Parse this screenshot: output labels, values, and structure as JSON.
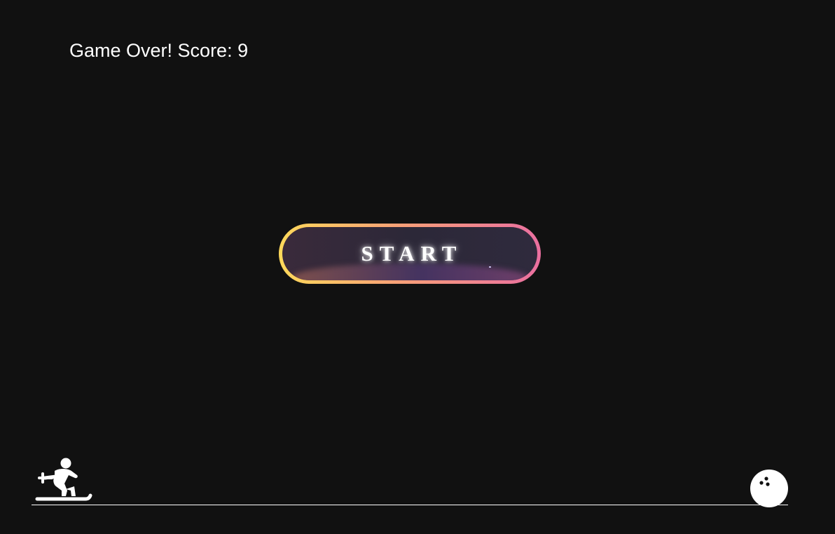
{
  "hud": {
    "status_text": "Game Over! Score: 9",
    "score": 9
  },
  "start_button": {
    "label": "START"
  },
  "player": {
    "icon": "skier-icon"
  },
  "obstacle": {
    "icon": "bowling-ball-icon"
  },
  "colors": {
    "background": "#111111",
    "text": "#ffffff",
    "button_gradient_start": "#ffd95a",
    "button_gradient_mid": "#f7a177",
    "button_gradient_end": "#ea6fa0",
    "button_fill": "#2c2838"
  }
}
